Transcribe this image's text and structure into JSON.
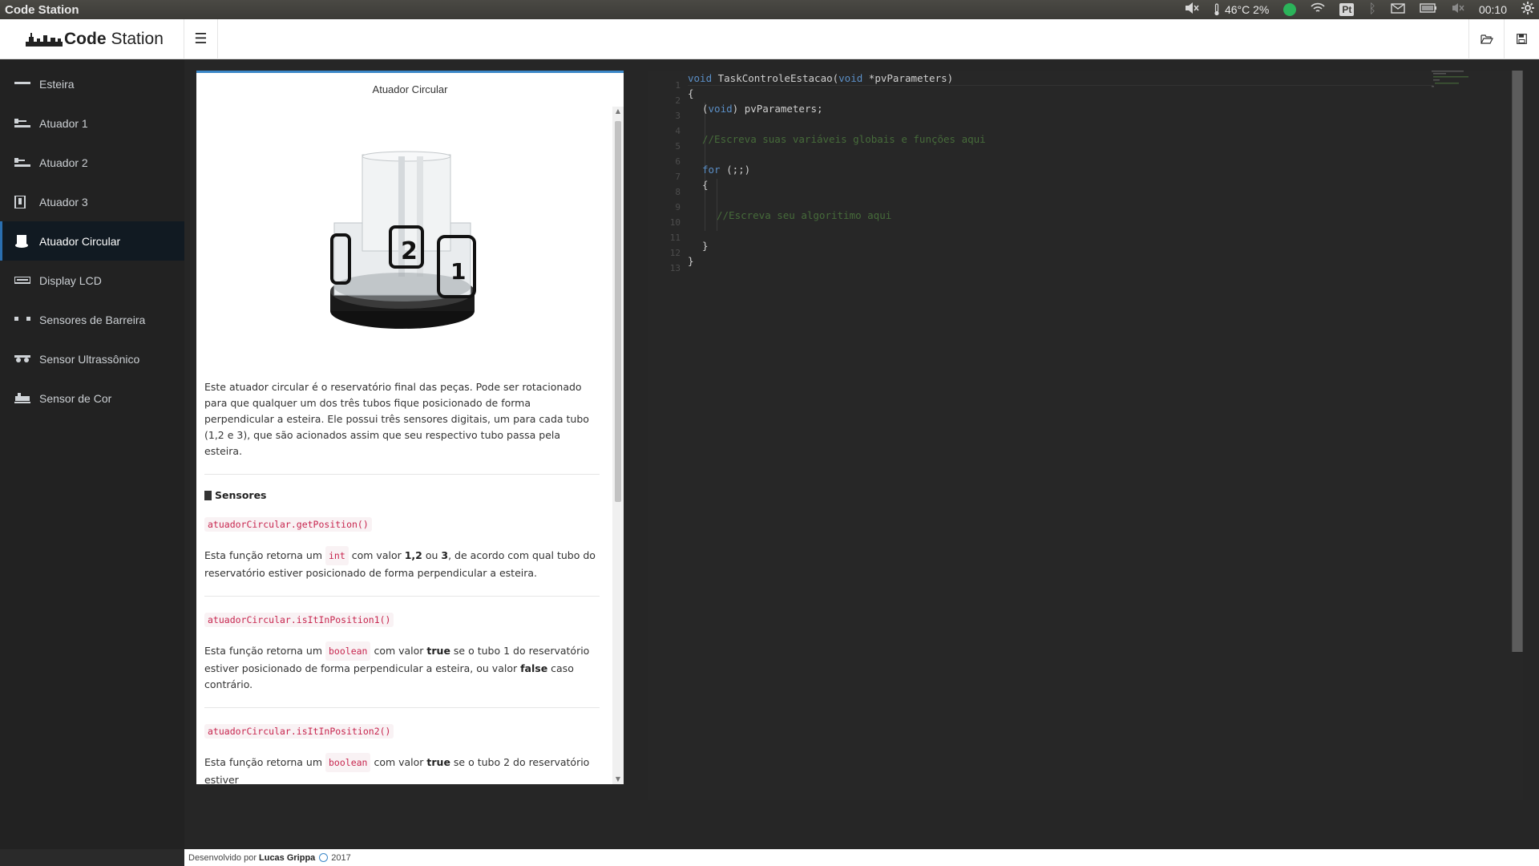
{
  "os_bar": {
    "title": "Code Station",
    "temperature": "46°C 2%",
    "keyboard_layout": "Pt",
    "time": "00:10"
  },
  "app": {
    "brand_bold": "Code",
    "brand_light": "Station"
  },
  "sidebar": {
    "items": [
      {
        "label": "Esteira",
        "icon": "conveyor-icon"
      },
      {
        "label": "Atuador 1",
        "icon": "actuator-icon"
      },
      {
        "label": "Atuador 2",
        "icon": "actuator-icon"
      },
      {
        "label": "Atuador 3",
        "icon": "actuator-vertical-icon"
      },
      {
        "label": "Atuador Circular",
        "icon": "circular-actuator-icon"
      },
      {
        "label": "Display LCD",
        "icon": "lcd-icon"
      },
      {
        "label": "Sensores de Barreira",
        "icon": "barrier-sensor-icon"
      },
      {
        "label": "Sensor Ultrassônico",
        "icon": "ultrasonic-icon"
      },
      {
        "label": "Sensor de Cor",
        "icon": "color-sensor-icon"
      }
    ],
    "active_index": 4
  },
  "doc": {
    "title": "Atuador Circular",
    "description": "Este atuador circular é o reservatório final das peças. Pode ser rotacionado para que qualquer um dos três tubos fique posicionado de forma perpendicular a esteira. Ele possui três sensores digitais, um para cada tubo (1,2 e 3), que são acionados assim que seu respectivo tubo passa pela esteira.",
    "sensors_heading": "Sensores",
    "functions": [
      {
        "code": "atuadorCircular.getPosition()",
        "d1": "Esta função retorna um ",
        "type": "int",
        "d2": " com valor ",
        "b1": "1,2",
        "d3": " ou ",
        "b2": "3",
        "d4": ", de acordo com qual tubo do reservatório estiver posicionado de forma perpendicular a esteira."
      },
      {
        "code": "atuadorCircular.isItInPosition1()",
        "d1": "Esta função retorna um ",
        "type": "boolean",
        "d2": " com valor ",
        "b1": "true",
        "d3": "  se o tubo 1 do reservatório estiver posicionado de forma perpendicular a esteira, ou valor ",
        "b2": "false",
        "d4": " caso contrário."
      },
      {
        "code": "atuadorCircular.isItInPosition2()",
        "d1": "Esta função retorna um ",
        "type": "boolean",
        "d2": " com valor ",
        "b1": "true",
        "d3": "  se o tubo 2 do reservatório estiver",
        "b2": "",
        "d4": ""
      }
    ]
  },
  "editor": {
    "line_numbers": [
      "1",
      "2",
      "3",
      "4",
      "5",
      "6",
      "7",
      "8",
      "9",
      "10",
      "11",
      "12",
      "13"
    ],
    "lines": {
      "l1_kw1": "void",
      "l1_fn": " TaskControleEstacao(",
      "l1_kw2": "void",
      "l1_rest": " *pvParameters)",
      "l2": "{",
      "l3_a": "(",
      "l3_kw": "void",
      "l3_b": ") pvParameters;",
      "l5": "//Escreva suas variáveis globais e funções aqui",
      "l7_kw": "for",
      "l7_rest": " (;;)",
      "l8": "{",
      "l10": "//Escreva seu algoritimo aqui",
      "l12": "}",
      "l13": "}"
    }
  },
  "footer": {
    "prefix": "Desenvolvido por",
    "author": "Lucas Grippa",
    "year": "2017"
  },
  "colors": {
    "accent": "#3b87c8",
    "sidebar_bg": "#222222",
    "editor_bg": "#272727",
    "code_chip": "#c7254e"
  }
}
